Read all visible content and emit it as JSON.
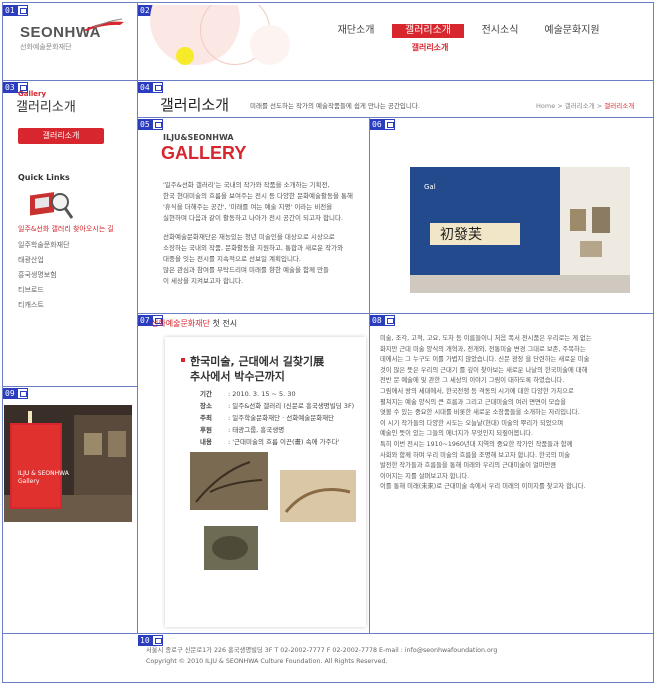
{
  "region_tags": [
    "01",
    "02",
    "03",
    "04",
    "05",
    "06",
    "07",
    "08",
    "09",
    "10"
  ],
  "logo": {
    "wordmark": "SEONHWA",
    "subtitle": "선화예술문화재단"
  },
  "nav": {
    "items": [
      {
        "label": "재단소개"
      },
      {
        "label": "갤러리소개"
      },
      {
        "label": "전시소식"
      },
      {
        "label": "예술문화지원"
      }
    ],
    "active_sub": "갤러리소개"
  },
  "sidebar": {
    "small_title": "Gallery",
    "title": "갤러리소개",
    "button": "갤러리소개",
    "quick_links_heading": "Quick Links",
    "quick_red": "일주&선화 갤러리 찾아오시는 길",
    "links": [
      "일주학술문화재단",
      "태광산업",
      "흥국생명보험",
      "티브로드",
      "티캐스트"
    ]
  },
  "page": {
    "title": "갤러리소개",
    "description": "미래를 선도하는 작가의 예술작품들에 쉽게 만나는 공간입니다.",
    "breadcrumb": [
      "Home",
      "갤러리소개",
      "갤러리소개"
    ]
  },
  "gallery_intro": {
    "kicker": "ILJU&SEONHWA",
    "heading": "GALLERY",
    "para1": [
      "'일주&선화 갤러리'는 국내의 작가와 작품을 소개하는 기획전,",
      "한국 현대미술의 흐름을 보여주는 전시 등 다양한 문화예술활동을 통해",
      "'휴식을 더해주는 공간', '미래를 여는 예술 지평' 이라는 비전을",
      "실현하며 다음과 같이 활동하고 나아가 전시 공간이 되고자 합니다."
    ],
    "para2": [
      "선화예술문화재단은 재능있는 청년 미술인을 대상으로 시상으로",
      "소장하는 국내외 작품, 문화활동을 지원하고, 통합과 새로운 작가와",
      "대중을 잇는 전시를 지속적으로 선보일 계획입니다.",
      "많은 관심과 참여를 부탁드리며 미래를 향한 예술을 함께 만들",
      "이 세상을 지켜보고자 합니다."
    ]
  },
  "exhibition": {
    "section_label_red": "선화예술문화재단",
    "section_label_rest": "첫 전시",
    "title_line1": "한국미술, 근대에서 길찾기展",
    "title_line2": "추사에서 박수근까지",
    "info": [
      {
        "k": "기간",
        "v": ": 2010. 3. 15 ~ 5. 30"
      },
      {
        "k": "장소",
        "v": ": 일주&선화 갤러리 (신문로 흥국생명빌딩 3F)"
      },
      {
        "k": "주최",
        "v": ": 일주학술문화재단 · 선화예술문화재단"
      },
      {
        "k": "후원",
        "v": ": 태광그룹, 흥국생명"
      },
      {
        "k": "내용",
        "v": ": '근대미술의 흐름 이끈(畫) 속에 가주다'"
      }
    ]
  },
  "article": [
    "미술, 조각, 고적, 고요, 도자 등 이름들이니 처음 폭서 전시품은 우리로는 게 없는",
    "화지만 근대 미술 양식의 개혁과, 전개와, 전통미술 변경 그대로 보존, 주목하는",
    "데에서는 그 누구도 이를 가볍지 않았습니다. 신문 광장 을 단련하는 새로운 미술",
    "것이 많은 뜻은 우리의 근대기 를 깊이 찾아보는 새로운 나날의 한국미술에 대해",
    "전반 문 예술에 및 관한 그 세상의 이야기 그림이 대하도록 하였습니다.",
    "그림에서 왕의 세대에서, 한국전쟁 등 격동의 시기에 대한 다양한 가치으로",
    "펼쳐지는 예술 양식의 큰 흐름과 그리고 근대미술의 여러 면면이 모습을",
    "엿볼 수 있는 중요한 시대를 비롯한 새로운 소장품들을 소개하는 자리입니다.",
    "이 시기 작가들의 다양한 시도는 오늘날(현대) 미술의 뿌리가 되었으며",
    "예술인 뜻이 있는 그들의 에너지가 무엇인지 되짚어봅니다.",
    "특히 이번 전시는 1910~1960년대 지역의 중요한 작가인 작품들과 함께",
    "사회와 함께 하며 우리 미술의 흐름을 조명해 보고자 합니다. 한국의 미술",
    "발전한 작가들과 흐름들을 통해 미래와 우리의 근대미술이 얼마만큼",
    "이어지는 지를 살펴보고자 합니다.",
    "이를 통해 미래(未來)로 근대미술 속에서 우리 미래의 이미지를 찾고자 합니다."
  ],
  "footer": {
    "line1": "서울시 종로구 신문로1가 226 흥국생명빌딩 3F  T 02-2002-7777  F 02-2002-7778  E-mail : info@seonhwafoundation.org",
    "line2": "Copyright © 2010 ILJU & SEONHWA Culture Foundation. All Rights Reserved."
  }
}
